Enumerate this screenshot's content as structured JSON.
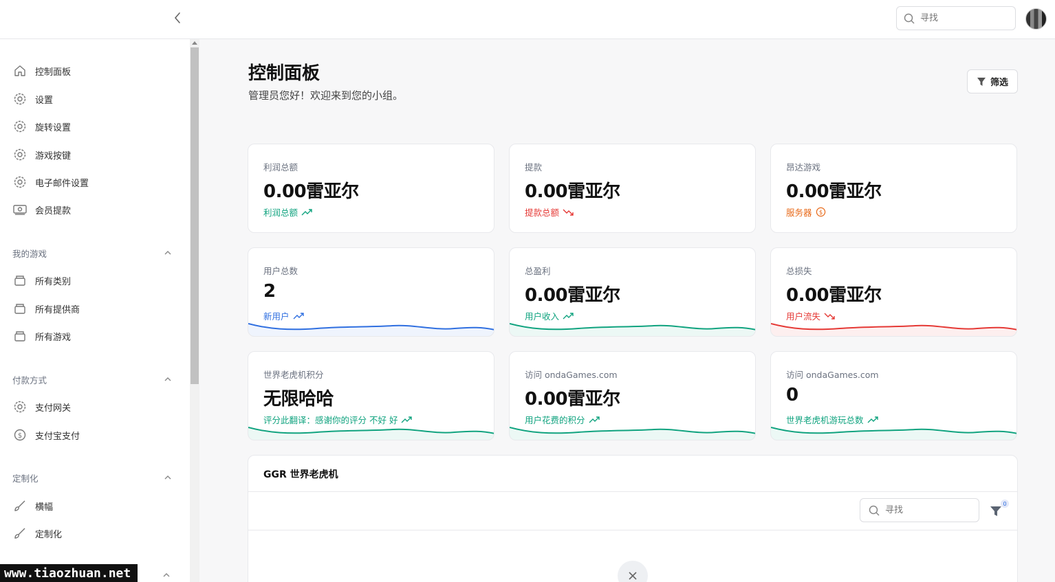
{
  "topbar": {
    "search_placeholder": "寻找"
  },
  "sidebar": {
    "items": [
      {
        "label": "控制面板",
        "icon": "home-icon"
      },
      {
        "label": "设置",
        "icon": "gear-icon"
      },
      {
        "label": "旋转设置",
        "icon": "gear-icon"
      },
      {
        "label": "游戏按键",
        "icon": "gear-icon"
      },
      {
        "label": "电子邮件设置",
        "icon": "gear-icon"
      },
      {
        "label": "会员提款",
        "icon": "cash-icon"
      }
    ],
    "sections": [
      {
        "title": "我的游戏",
        "items": [
          {
            "label": "所有类别"
          },
          {
            "label": "所有提供商"
          },
          {
            "label": "所有游戏"
          }
        ]
      },
      {
        "title": "付款方式",
        "items": [
          {
            "label": "支付网关"
          },
          {
            "label": "支付宝支付"
          }
        ]
      },
      {
        "title": "定制化",
        "items": [
          {
            "label": "横幅"
          },
          {
            "label": "定制化"
          }
        ]
      }
    ]
  },
  "main": {
    "title": "控制面板",
    "subtitle": "管理员您好！欢迎来到您的小组。",
    "filter_label": "筛选"
  },
  "cards": [
    {
      "label": "利润总额",
      "value": "0.00雷亚尔",
      "trend": "利润总额",
      "color": "#10a37f",
      "dir": "up"
    },
    {
      "label": "提款",
      "value": "0.00雷亚尔",
      "trend": "提款总额",
      "color": "#e53935",
      "dir": "down"
    },
    {
      "label": "昂达游戏",
      "value": "0.00雷亚尔",
      "trend": "服务器",
      "color": "#e86a1a",
      "dir": "coin"
    },
    {
      "label": "用户总数",
      "value": "2",
      "trend": "新用户",
      "color": "#2f6fe0",
      "dir": "up"
    },
    {
      "label": "总盈利",
      "value": "0.00雷亚尔",
      "trend": "用户收入",
      "color": "#10a37f",
      "dir": "up"
    },
    {
      "label": "总损失",
      "value": "0.00雷亚尔",
      "trend": "用户流失",
      "color": "#e53935",
      "dir": "down"
    },
    {
      "label": "世界老虎机积分",
      "value": "无限哈哈",
      "trend": "评分此翻译：感谢你的评分 不好 好",
      "color": "#10a37f",
      "dir": "up"
    },
    {
      "label": "访问 ondaGames.com",
      "value": "0.00雷亚尔",
      "trend": "用户花费的积分",
      "color": "#10a37f",
      "dir": "up"
    },
    {
      "label": "访问 ondaGames.com",
      "value": "0",
      "trend": "世界老虎机游玩总数",
      "color": "#10a37f",
      "dir": "up"
    }
  ],
  "table": {
    "title": "GGR 世界老虎机",
    "search_placeholder": "寻找",
    "filter_count": "0"
  },
  "watermark": "www.tiaozhuan.net"
}
